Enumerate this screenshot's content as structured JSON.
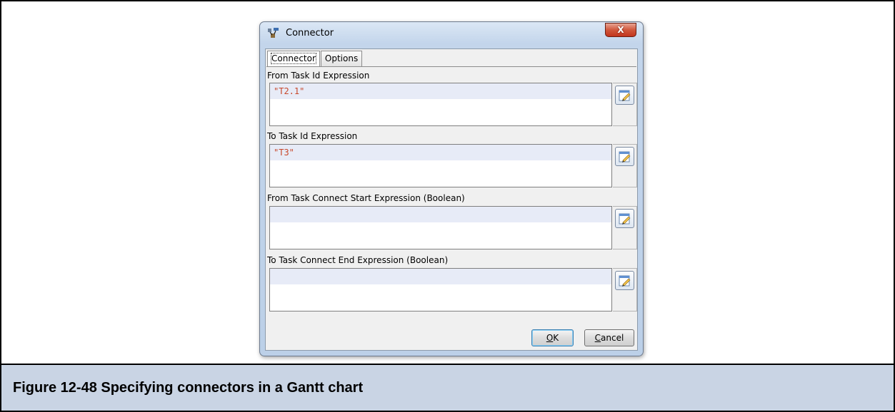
{
  "dialog": {
    "title": "Connector",
    "close_glyph": "X",
    "icon": "connector-app-icon"
  },
  "tabs": [
    {
      "label": "Connector",
      "active": true
    },
    {
      "label": "Options",
      "active": false
    }
  ],
  "fields": [
    {
      "label": "From Task Id Expression",
      "value": "\"T2.1\""
    },
    {
      "label": "To Task Id Expression",
      "value": "\"T3\""
    },
    {
      "label": "From Task Connect Start Expression (Boolean)",
      "value": ""
    },
    {
      "label": "To Task Connect End Expression (Boolean)",
      "value": ""
    }
  ],
  "buttons": {
    "ok_mnemonic": "O",
    "ok_rest": "K",
    "cancel_mnemonic": "C",
    "cancel_rest": "ancel"
  },
  "caption": "Figure 12-48  Specifying connectors in a Gantt chart",
  "colors": {
    "expression_text": "#c8472b",
    "caption_background": "#c9d4e4",
    "close_button": "#c2341c"
  }
}
